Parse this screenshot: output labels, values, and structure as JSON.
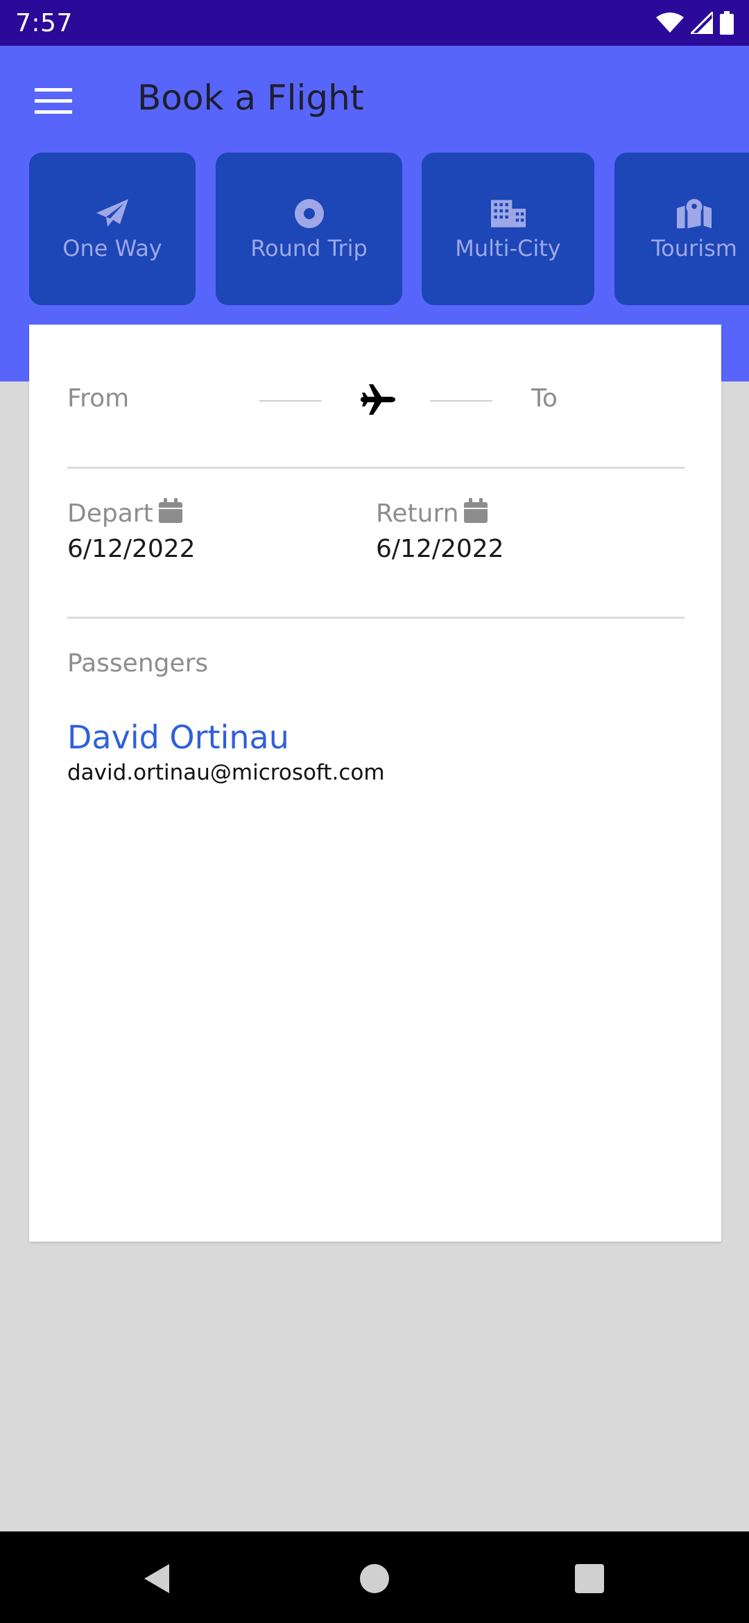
{
  "status_bar": {
    "time": "7:57",
    "icons": [
      "wifi-icon",
      "signal-icon",
      "battery-icon"
    ]
  },
  "header": {
    "title": "Book a Flight",
    "menu_icon": "hamburger-menu-icon"
  },
  "trip_types": [
    {
      "label": "One Way",
      "icon": "paper-plane-icon"
    },
    {
      "label": "Round Trip",
      "icon": "target-icon"
    },
    {
      "label": "Multi-City",
      "icon": "city-buildings-icon"
    },
    {
      "label": "Tourism",
      "icon": "map-marker-icon"
    }
  ],
  "route": {
    "from_label": "From",
    "to_label": "To",
    "icon": "airplane-icon"
  },
  "dates": {
    "depart_label": "Depart",
    "depart_value": "6/12/2022",
    "return_label": "Return",
    "return_value": "6/12/2022",
    "icon": "calendar-icon"
  },
  "passengers": {
    "label": "Passengers",
    "name": "David Ortinau",
    "email": "david.ortinau@microsoft.com"
  },
  "colors": {
    "status_bar": "#2b0a9a",
    "header": "#5865fb",
    "tab": "#1d46b7",
    "tab_text": "#9ea8e6",
    "link": "#2f5fd9",
    "background": "#d9d9d9"
  }
}
